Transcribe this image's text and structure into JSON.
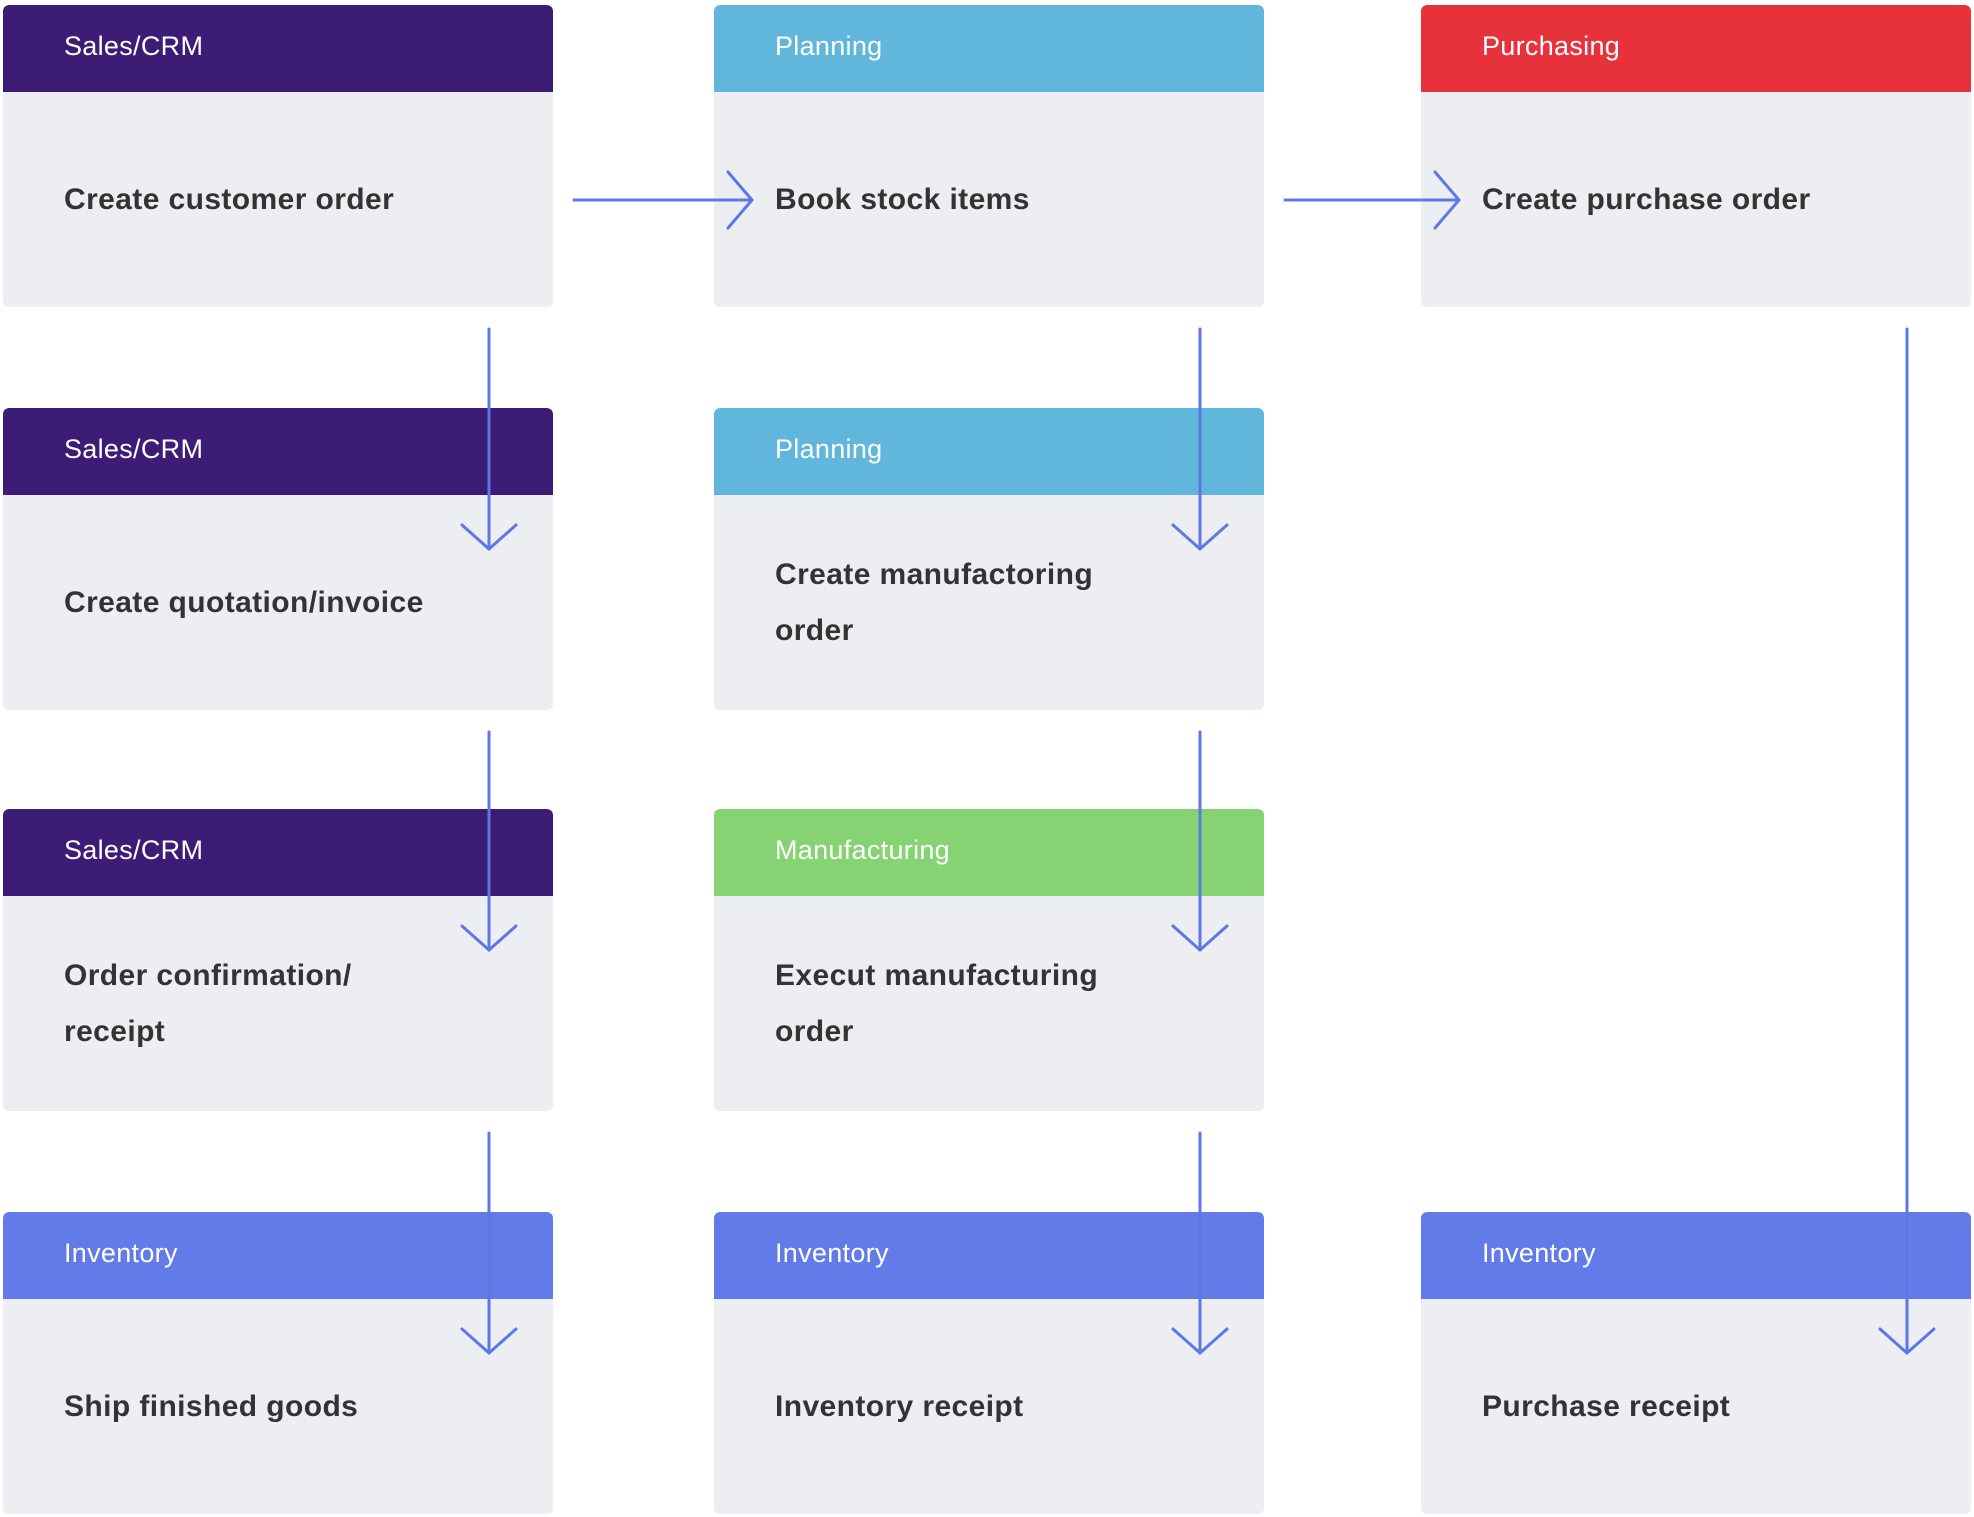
{
  "colors": {
    "Sales/CRM": "#3c1c74",
    "Planning": "#60b6db",
    "Purchasing": "#e8323b",
    "Manufacturing": "#85d372",
    "Inventory": "#627be8",
    "arrow": "#5b78e6",
    "card_body": "#edeef2",
    "text": "#333333"
  },
  "cards": [
    {
      "id": "c1",
      "col": 0,
      "row": 0,
      "category": "Sales/CRM",
      "label": "Create customer order"
    },
    {
      "id": "c2",
      "col": 1,
      "row": 0,
      "category": "Planning",
      "label": "Book stock items"
    },
    {
      "id": "c3",
      "col": 2,
      "row": 0,
      "category": "Purchasing",
      "label": "Create purchase order"
    },
    {
      "id": "c4",
      "col": 0,
      "row": 1,
      "category": "Sales/CRM",
      "label": "Create quotation/invoice"
    },
    {
      "id": "c5",
      "col": 1,
      "row": 1,
      "category": "Planning",
      "label": "Create manufactoring order"
    },
    {
      "id": "c6",
      "col": 0,
      "row": 2,
      "category": "Sales/CRM",
      "label": "Order confirmation/ receipt"
    },
    {
      "id": "c7",
      "col": 1,
      "row": 2,
      "category": "Manufacturing",
      "label": "Execut manufacturing order"
    },
    {
      "id": "c8",
      "col": 0,
      "row": 3,
      "category": "Inventory",
      "label": "Ship finished goods"
    },
    {
      "id": "c9",
      "col": 1,
      "row": 3,
      "category": "Inventory",
      "label": "Inventory receipt"
    },
    {
      "id": "c10",
      "col": 2,
      "row": 3,
      "category": "Inventory",
      "label": "Purchase receipt"
    }
  ],
  "connections": [
    {
      "from": "c1",
      "to": "c2",
      "direction": "right"
    },
    {
      "from": "c2",
      "to": "c3",
      "direction": "right"
    },
    {
      "from": "c1",
      "to": "c4",
      "direction": "down"
    },
    {
      "from": "c4",
      "to": "c6",
      "direction": "down"
    },
    {
      "from": "c6",
      "to": "c8",
      "direction": "down"
    },
    {
      "from": "c2",
      "to": "c5",
      "direction": "down"
    },
    {
      "from": "c5",
      "to": "c7",
      "direction": "down"
    },
    {
      "from": "c7",
      "to": "c9",
      "direction": "down"
    },
    {
      "from": "c3",
      "to": "c10",
      "direction": "down"
    }
  ]
}
